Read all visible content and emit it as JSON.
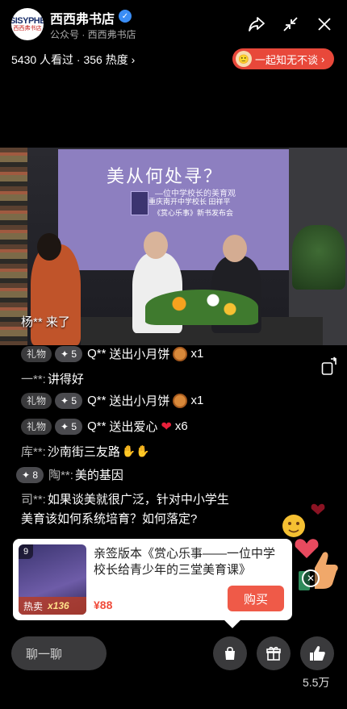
{
  "account": {
    "logo_text_top": "SISYPHE",
    "logo_text_bottom": "西西弗书店",
    "name": "西西弗书店",
    "subtitle": "公众号 · 西西弗书店"
  },
  "stats": {
    "text": "5430 人看过 · 356 热度 ›"
  },
  "promo_pill": {
    "label": "一起知无不谈",
    "arrow": "›"
  },
  "stream": {
    "screen_title": "美从何处寻？",
    "screen_subtitle": "—位中学校长的美育观",
    "screen_line1": "重庆南开中学校长 田祥平",
    "screen_line2": "《赏心乐事》新书发布会"
  },
  "join_notice": "杨** 来了",
  "comments": [
    {
      "tag": "礼物",
      "level": "✦ 5",
      "user": "Q**",
      "text": "送出小月饼",
      "emoji": "cake",
      "count": "x1"
    },
    {
      "tag": "",
      "level": "",
      "user": "一**:",
      "text": "讲得好",
      "emoji": "",
      "count": ""
    },
    {
      "tag": "礼物",
      "level": "✦ 5",
      "user": "Q**",
      "text": "送出小月饼",
      "emoji": "cake",
      "count": "x1"
    },
    {
      "tag": "礼物",
      "level": "✦ 5",
      "user": "Q**",
      "text": "送出爱心",
      "emoji": "heart",
      "count": "x6"
    },
    {
      "tag": "",
      "level": "",
      "user": "库**:",
      "text": "沙南街三友路",
      "emoji": "hands",
      "count": ""
    },
    {
      "tag": "",
      "level": "✦ 8",
      "user": "陶**:",
      "text": "美的基因",
      "emoji": "",
      "count": ""
    },
    {
      "tag": "",
      "level": "",
      "user": "司**:",
      "text": "如果谈美就很广泛，针对中小学生",
      "emoji": "",
      "count": ""
    }
  ],
  "comment_continuation": "美育该如何系统培育？如何落定?",
  "product": {
    "index": "9",
    "title": "亲签版本《赏心乐事——一位中学校长给青少年的三堂美育课》",
    "hot_label": "热卖",
    "sold": "x136",
    "price": "¥88",
    "buy_label": "购买"
  },
  "bottom_bar": {
    "chat_placeholder": "聊一聊",
    "like_count": "5.5万"
  },
  "icons": {
    "share": "share-icon",
    "minimize": "minimize-icon",
    "close": "close-icon",
    "rotate": "rotate-screen-icon",
    "bag": "shopping-bag-icon",
    "gift": "gift-icon",
    "like": "thumbs-up-icon"
  },
  "colors": {
    "background": "#000000",
    "accent_red": "#ef5a48",
    "verified_blue": "#3a8df5",
    "pill_red": "#e8483a"
  }
}
